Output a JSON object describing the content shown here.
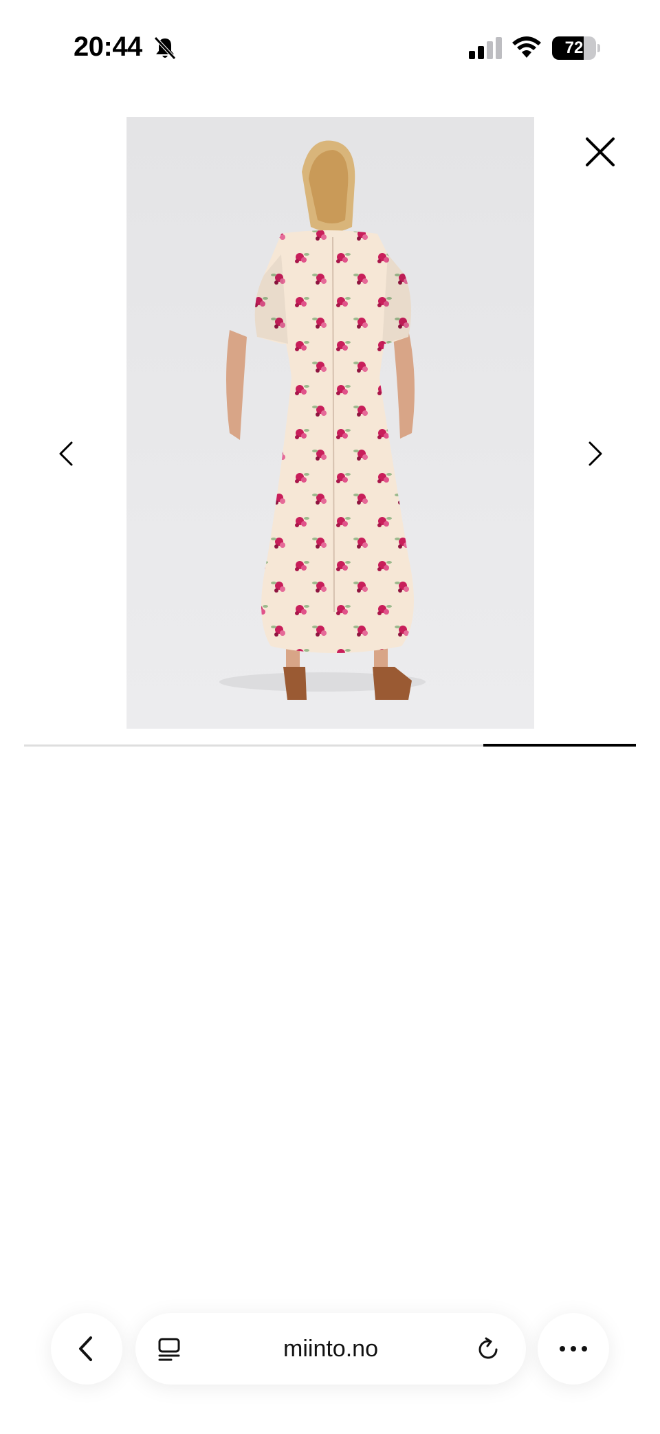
{
  "status_bar": {
    "time": "20:44",
    "battery_percent": "72",
    "battery_level": 0.72
  },
  "gallery": {
    "image_alt": "Floral print maxi dress, back view",
    "progress": {
      "active_segment": 4,
      "total_segments": 4
    }
  },
  "browser": {
    "url": "miinto.no"
  },
  "icons": {
    "bell": "bell-slash-icon",
    "close": "close-icon",
    "prev": "chevron-left-icon",
    "next": "chevron-right-icon",
    "back": "chevron-left-icon",
    "reader": "reader-mode-icon",
    "reload": "reload-icon",
    "more": "more-dots-icon"
  },
  "colors": {
    "dress": "#f6e7d6",
    "flower": "#c81e5a",
    "leaf": "#9bb98c",
    "shoe": "#9a5a33"
  }
}
